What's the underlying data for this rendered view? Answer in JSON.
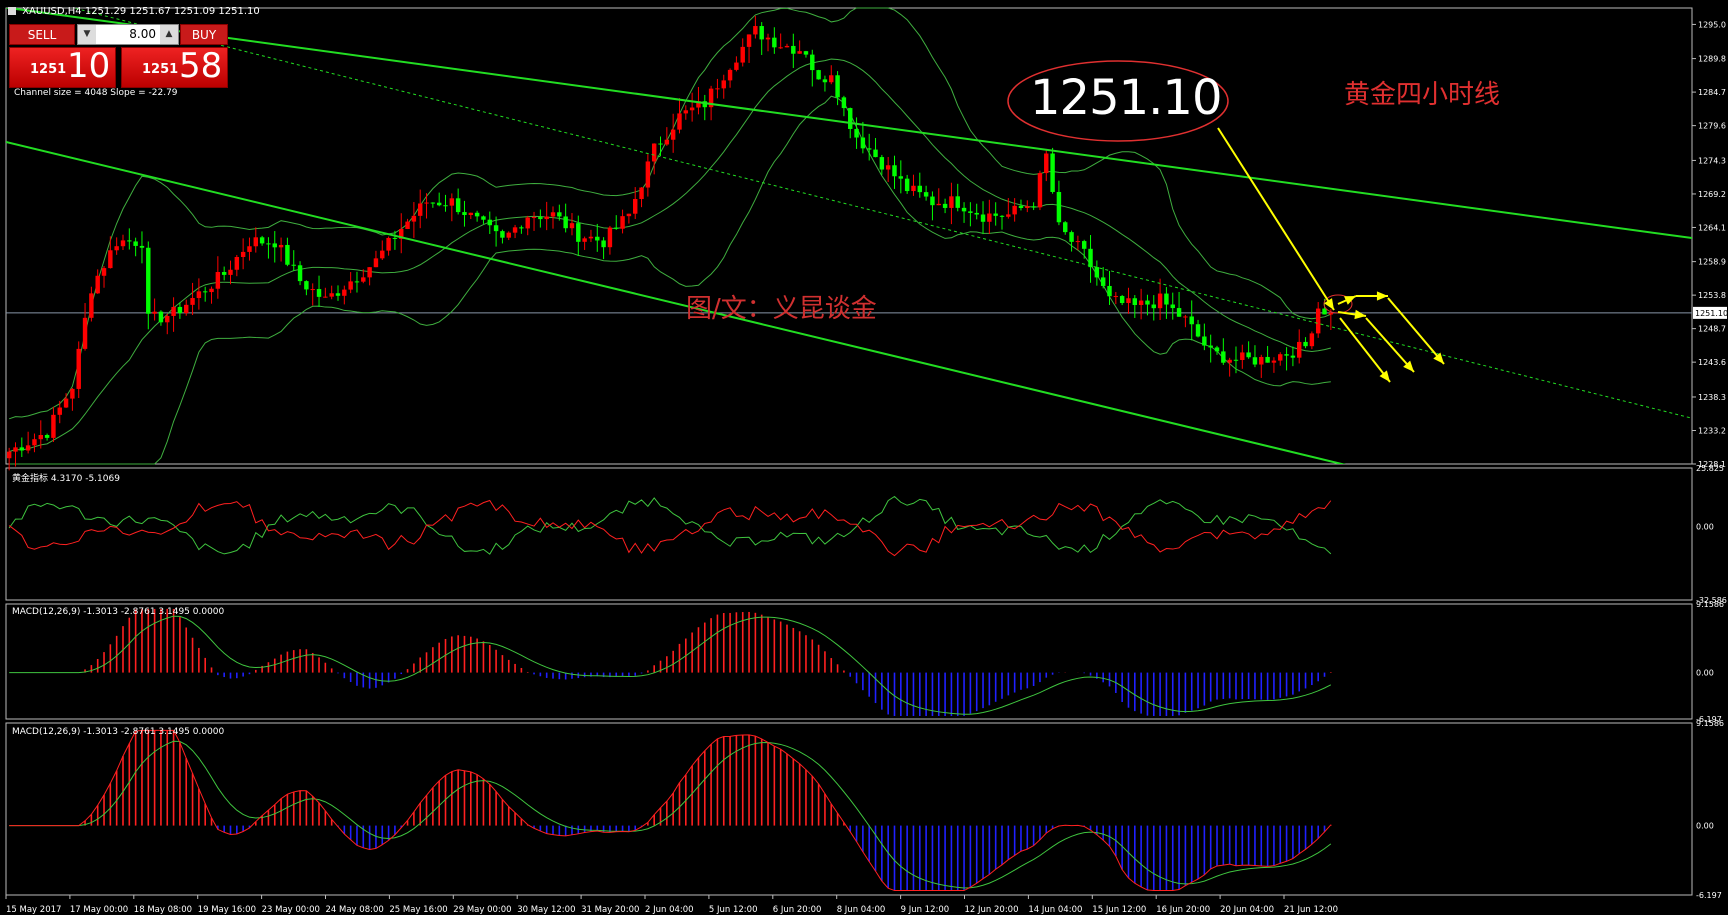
{
  "window": {
    "title": "XAUUSD,H4",
    "ohlc": "1251.29 1251.67 1251.09 1251.10"
  },
  "trade_panel": {
    "sell_label": "SELL",
    "buy_label": "BUY",
    "lot_size": "8.00",
    "sell_price_small": "1251",
    "sell_price_big": "10",
    "buy_price_small": "1251",
    "buy_price_big": "58",
    "channel_info": "Channel size = 4048 Slope = -22.79"
  },
  "annotations": {
    "big_price": "1251.10",
    "title_cn": "黄金四小时线",
    "watermark": "图/文：义昆谈金"
  },
  "colors": {
    "background": "#000000",
    "bull": "#ff0000",
    "bear": "#00ff00",
    "channel": "#22dd22",
    "arrow": "#ffff00",
    "annotation_red": "#e03030",
    "macd_pos": "#ff2020",
    "macd_neg": "#2020ff"
  },
  "chart_data": [
    {
      "type": "candlestick",
      "symbol": "XAUUSD",
      "timeframe": "H4",
      "current_price": 1251.1,
      "ylim": [
        1228.1,
        1297.5
      ],
      "y_ticks": [
        "1295.0",
        "1289.8",
        "1284.7",
        "1279.6",
        "1274.3",
        "1269.2",
        "1264.1",
        "1258.9",
        "1253.8",
        "1248.7",
        "1243.6",
        "1238.3",
        "1233.2",
        "1228.1"
      ],
      "current_price_label": "1251.10",
      "x_ticks": [
        "15 May 2017",
        "17 May 00:00",
        "18 May 08:00",
        "19 May 16:00",
        "23 May 00:00",
        "24 May 08:00",
        "25 May 16:00",
        "29 May 00:00",
        "30 May 12:00",
        "31 May 20:00",
        "2 Jun 04:00",
        "5 Jun 12:00",
        "6 Jun 20:00",
        "8 Jun 04:00",
        "9 Jun 12:00",
        "12 Jun 20:00",
        "14 Jun 04:00",
        "15 Jun 12:00",
        "16 Jun 20:00",
        "20 Jun 04:00",
        "21 Jun 12:00"
      ],
      "close_path": [
        [
          0,
          1230
        ],
        [
          6,
          1233
        ],
        [
          10,
          1240
        ],
        [
          13,
          1255
        ],
        [
          17,
          1262
        ],
        [
          21,
          1262
        ],
        [
          22,
          1250
        ],
        [
          26,
          1251
        ],
        [
          30,
          1254
        ],
        [
          34,
          1257
        ],
        [
          38,
          1262
        ],
        [
          42,
          1262
        ],
        [
          46,
          1256
        ],
        [
          50,
          1253
        ],
        [
          54,
          1256
        ],
        [
          58,
          1259
        ],
        [
          62,
          1264
        ],
        [
          66,
          1268
        ],
        [
          70,
          1268
        ],
        [
          74,
          1265
        ],
        [
          78,
          1262
        ],
        [
          82,
          1266
        ],
        [
          86,
          1266
        ],
        [
          90,
          1263
        ],
        [
          94,
          1262
        ],
        [
          98,
          1266
        ],
        [
          102,
          1276
        ],
        [
          106,
          1281
        ],
        [
          110,
          1283
        ],
        [
          114,
          1289
        ],
        [
          118,
          1294
        ],
        [
          122,
          1292
        ],
        [
          126,
          1291
        ],
        [
          128,
          1286
        ],
        [
          130,
          1288
        ],
        [
          132,
          1282
        ],
        [
          134,
          1278
        ],
        [
          138,
          1274
        ],
        [
          142,
          1270
        ],
        [
          146,
          1268
        ],
        [
          150,
          1268
        ],
        [
          154,
          1266
        ],
        [
          158,
          1266
        ],
        [
          160,
          1267
        ],
        [
          162,
          1268
        ],
        [
          164,
          1275
        ],
        [
          166,
          1264
        ],
        [
          170,
          1260
        ],
        [
          174,
          1253
        ],
        [
          178,
          1252
        ],
        [
          182,
          1253
        ],
        [
          186,
          1250
        ],
        [
          190,
          1245
        ],
        [
          194,
          1244
        ],
        [
          198,
          1244
        ],
        [
          202,
          1245
        ],
        [
          205,
          1246
        ],
        [
          207,
          1252
        ],
        [
          209,
          1251.1
        ]
      ],
      "upper_channel": [
        [
          0,
          1297.5
        ],
        [
          209,
          1270
        ]
      ],
      "lower_channel": [
        [
          0,
          1277
        ],
        [
          209,
          1228.5
        ]
      ],
      "mid_channel": [
        [
          0,
          1300
        ],
        [
          209,
          1249
        ]
      ]
    },
    {
      "type": "line",
      "title": "黄金指标 4.3170 -5.1069",
      "ylim": [
        -32.586,
        25.825
      ],
      "y_ticks": [
        "25.825",
        "0.00",
        "-32.586"
      ]
    },
    {
      "type": "bar",
      "title": "MACD(12,26,9) -1.3013 -2.8761 3.1495 0.0000",
      "ylim": [
        -6.197,
        9.1586
      ],
      "y_ticks": [
        "9.1586",
        "0.00",
        "-6.197"
      ]
    },
    {
      "type": "bar",
      "title": "MACD(12,26,9) -1.3013 -2.8761 3.1495 0.0000",
      "ylim": [
        -6.197,
        9.1586
      ],
      "y_ticks": [
        "9.1586",
        "0.00",
        "-6.197"
      ]
    }
  ]
}
